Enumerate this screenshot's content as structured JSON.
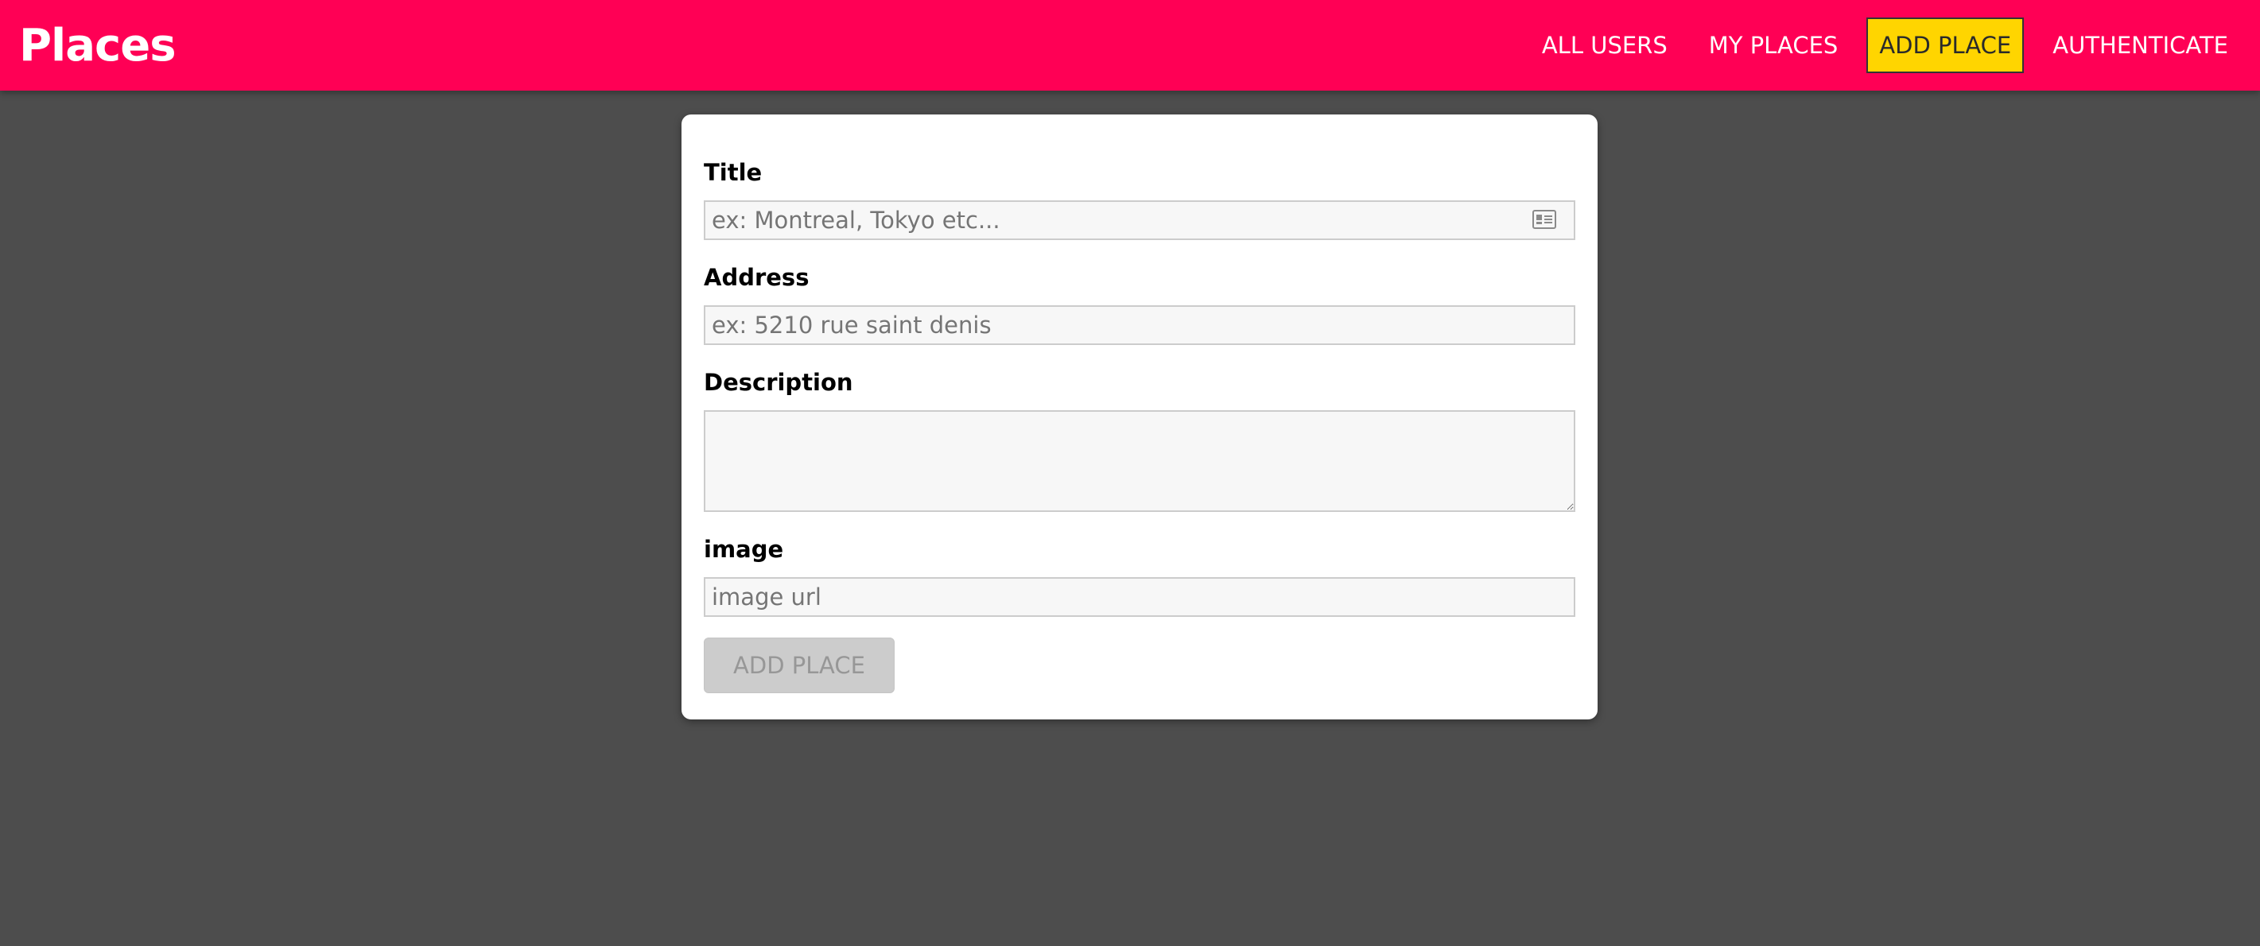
{
  "header": {
    "brand": "Places",
    "nav": [
      {
        "label": "ALL USERS"
      },
      {
        "label": "MY PLACES"
      },
      {
        "label": "ADD PLACE",
        "active": true
      },
      {
        "label": "AUTHENTICATE"
      }
    ]
  },
  "form": {
    "title": {
      "label": "Title",
      "placeholder": "ex: Montreal, Tokyo etc...",
      "value": ""
    },
    "address": {
      "label": "Address",
      "placeholder": "ex: 5210 rue saint denis",
      "value": ""
    },
    "description": {
      "label": "Description",
      "value": ""
    },
    "image": {
      "label": "image",
      "placeholder": "image url",
      "value": ""
    },
    "submit_label": "ADD PLACE",
    "submit_disabled": true
  },
  "icons": {
    "autofill": "contact-card-icon"
  },
  "colors": {
    "header_bg": "#ff0055",
    "page_bg": "#4d4d4d",
    "active_nav_bg": "#ffd500",
    "card_bg": "#ffffff",
    "input_bg": "#f7f7f7",
    "disabled_button_bg": "#cccccc"
  }
}
